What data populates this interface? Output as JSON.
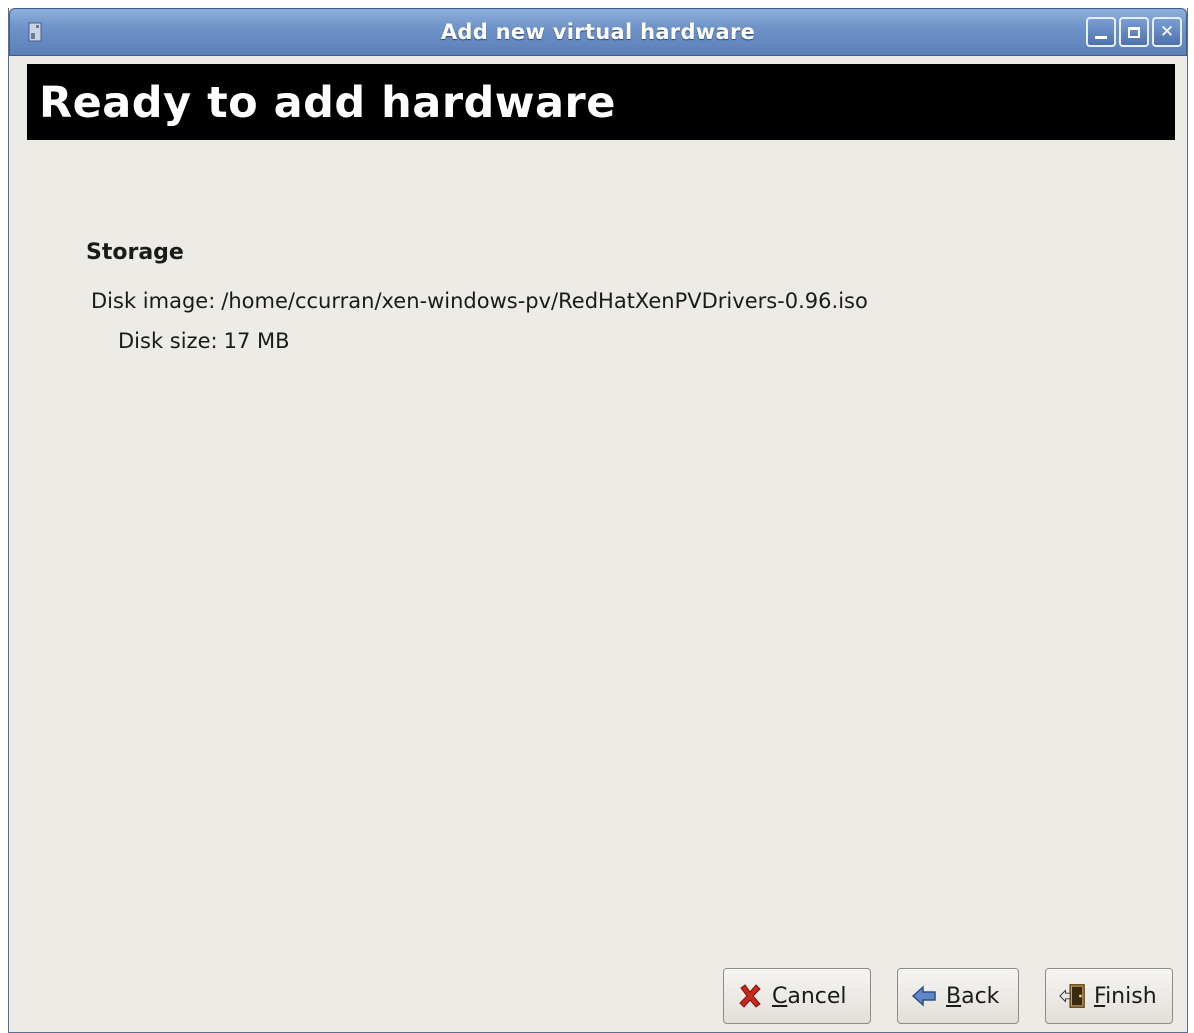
{
  "window": {
    "title": "Add new virtual hardware",
    "app_icon": "computer-icon"
  },
  "banner": {
    "title": "Ready to add hardware"
  },
  "summary": {
    "section_heading": "Storage",
    "rows": [
      {
        "label": "Disk image:",
        "value": "/home/ccurran/xen-windows-pv/RedHatXenPVDrivers-0.96.iso"
      },
      {
        "label": "Disk size:",
        "value": "17 MB"
      }
    ]
  },
  "buttons": {
    "cancel": {
      "mnemonic": "C",
      "rest": "ancel",
      "icon": "cancel-x-icon"
    },
    "back": {
      "mnemonic": "B",
      "rest": "ack",
      "icon": "back-arrow-icon"
    },
    "finish": {
      "mnemonic": "F",
      "rest": "inish",
      "icon": "finish-door-icon"
    }
  },
  "colors": {
    "titlebar": "#6f93c8",
    "banner_bg": "#000000",
    "window_bg": "#edebe6"
  }
}
